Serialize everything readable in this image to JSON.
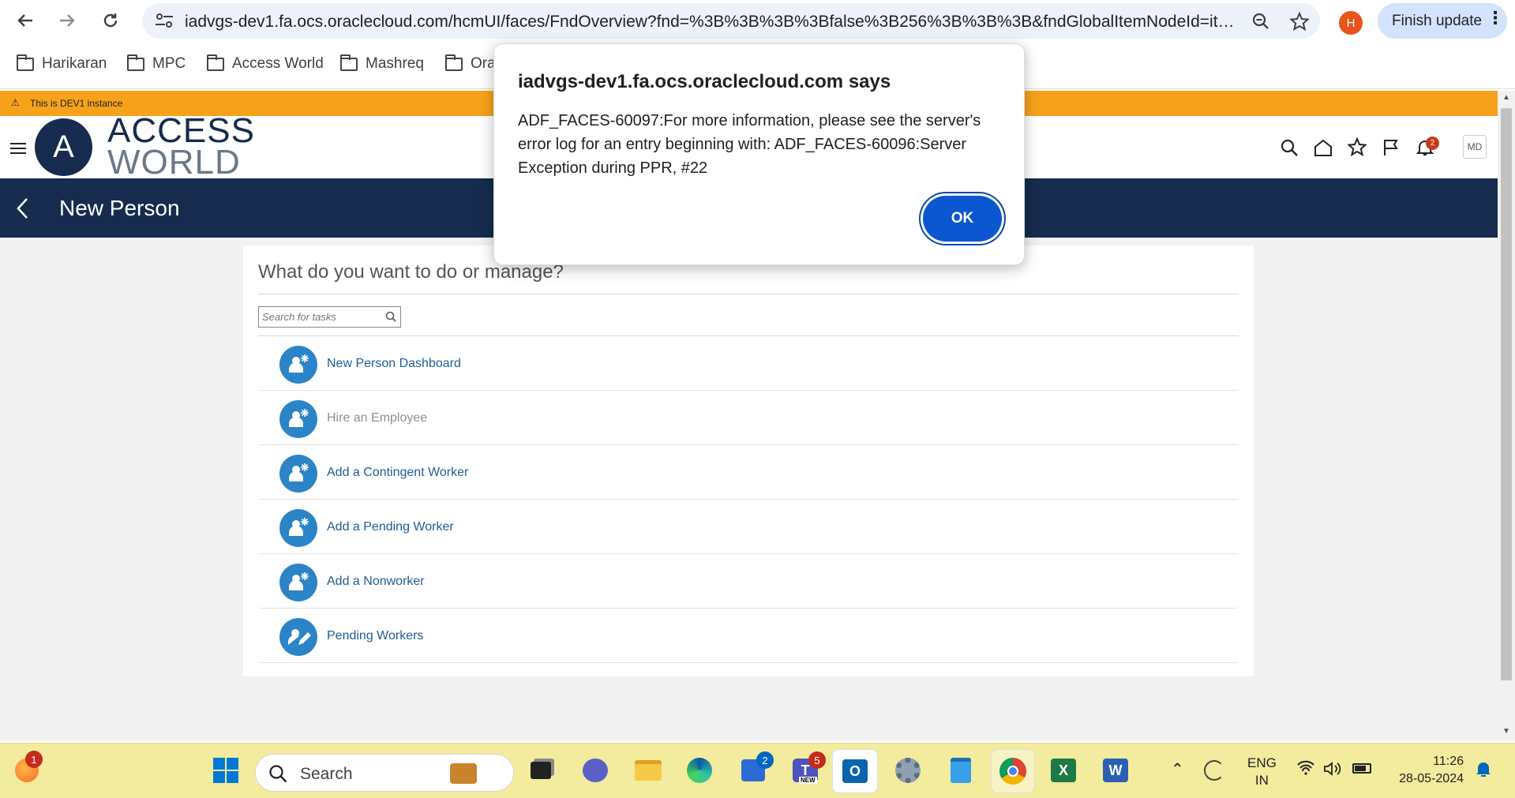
{
  "browser": {
    "url": "iadvgs-dev1.fa.ocs.oraclecloud.com/hcmUI/faces/FndOverview?fnd=%3B%3B%3B%3Bfalse%3B256%3B%3B%3B&fndGlobalItemNodeId=item...",
    "profile_initial": "H",
    "finish_update_label": "Finish update",
    "bookmarks": [
      "Harikaran",
      "MPC",
      "Access World",
      "Mashreq",
      "Ora"
    ]
  },
  "app": {
    "dev_banner": "This is DEV1 instance",
    "logo": {
      "letter": "A",
      "line1": "ACCESS",
      "line2": "WORLD"
    },
    "notification_count": "2",
    "user_initials": "MD",
    "page_title": "New Person",
    "panel_heading": "What do you want to do or manage?",
    "search_placeholder": "Search for tasks",
    "tasks": [
      {
        "label": "New Person Dashboard",
        "enabled": true
      },
      {
        "label": "Hire an Employee",
        "enabled": false
      },
      {
        "label": "Add a Contingent Worker",
        "enabled": true
      },
      {
        "label": "Add a Pending Worker",
        "enabled": true
      },
      {
        "label": "Add a Nonworker",
        "enabled": true
      },
      {
        "label": "Pending Workers",
        "enabled": true
      }
    ]
  },
  "dialog": {
    "title": "iadvgs-dev1.fa.ocs.oraclecloud.com says",
    "message": "ADF_FACES-60097:For more information, please see the server's error log for an entry beginning with: ADF_FACES-60096:Server Exception during PPR, #22",
    "ok_label": "OK"
  },
  "taskbar": {
    "search_label": "Search",
    "weather_badge": "1",
    "store_badge": "2",
    "teams_badge": "5",
    "teams_new_label": "NEW",
    "lang_line1": "ENG",
    "lang_line2": "IN",
    "time": "11:26",
    "date": "28-05-2024"
  },
  "colors": {
    "banner": "#f7a21b",
    "page_bar": "#162b4d",
    "link": "#1c5e95",
    "task_icon": "#2b84c7",
    "dialog_button": "#0b57d0"
  }
}
